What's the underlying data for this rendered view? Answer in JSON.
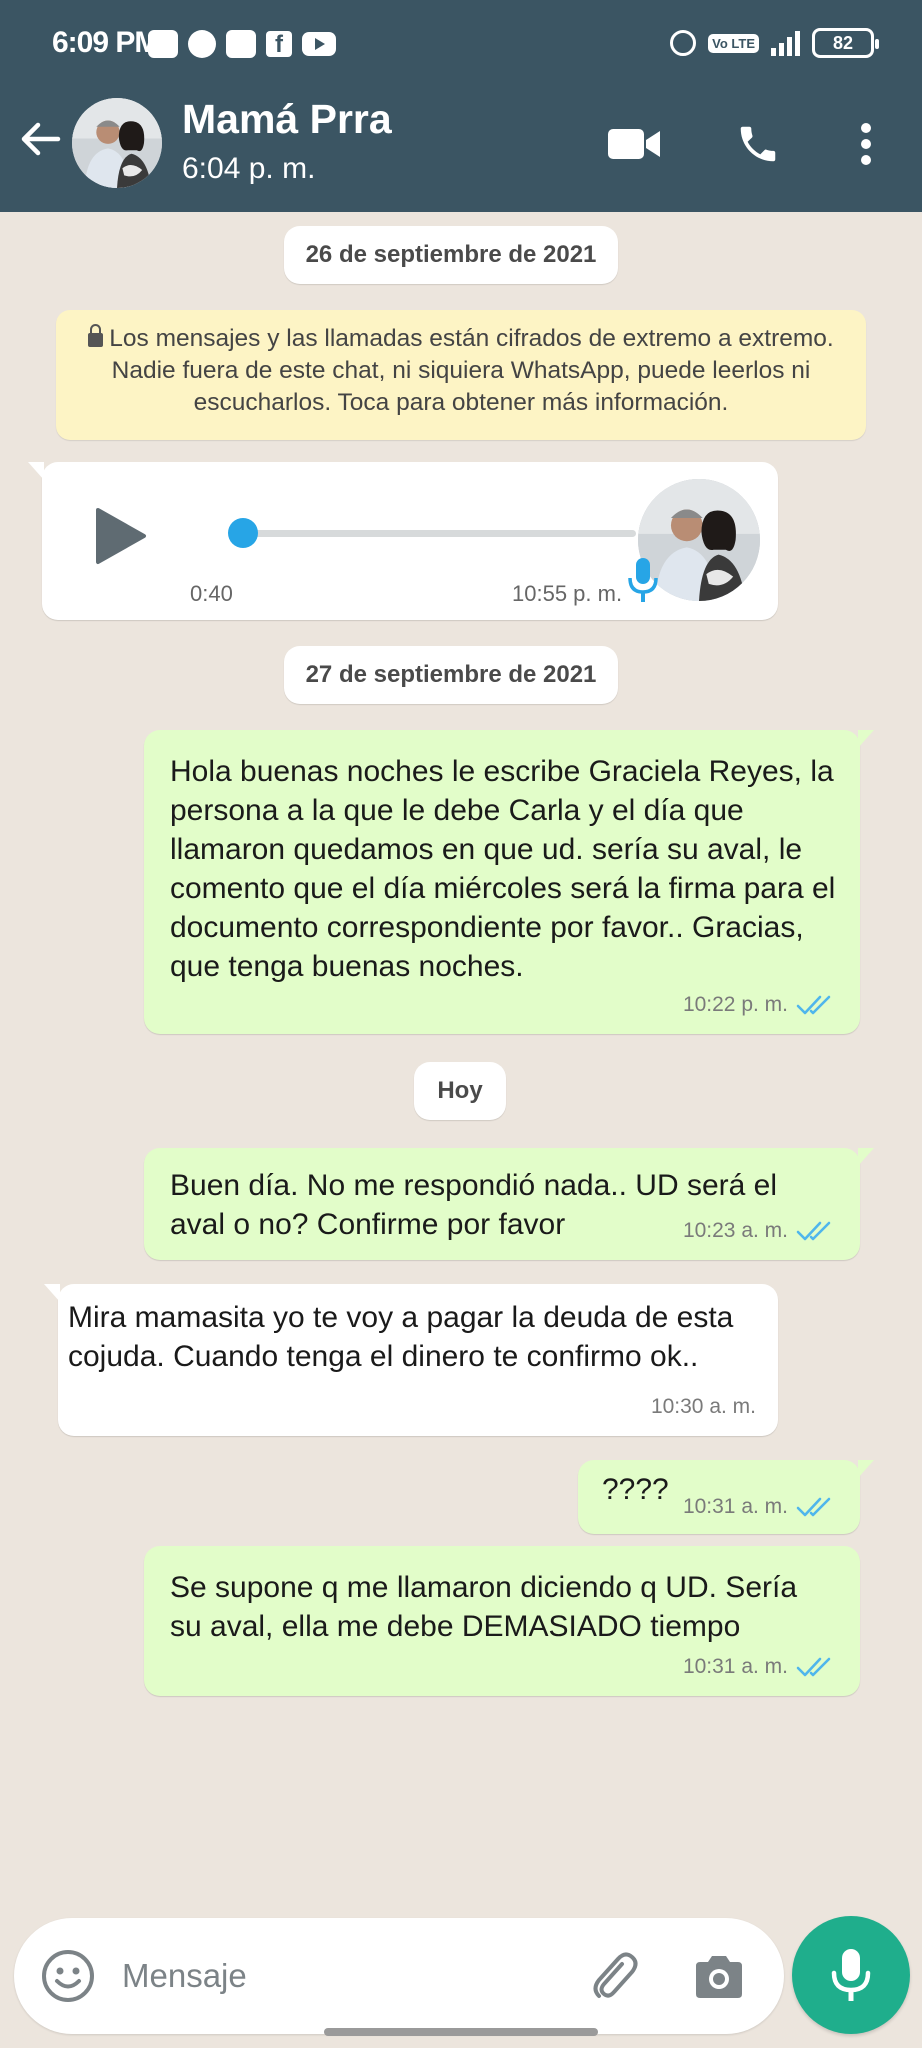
{
  "status_bar": {
    "time": "6:09 PM",
    "battery": "82"
  },
  "header": {
    "contact_name": "Mamá Prra",
    "last_seen": "6:04 p. m."
  },
  "chat": {
    "date_chip_1": "26 de septiembre de 2021",
    "encryption_notice": "Los mensajes y las llamadas están cifrados de extremo a extremo. Nadie fuera de este chat, ni siquiera WhatsApp, puede leerlos ni escucharlos. Toca para obtener más información.",
    "voice_note": {
      "duration": "0:40",
      "time": "10:55 p. m.",
      "progress": 0
    },
    "date_chip_2": "27 de septiembre de 2021",
    "date_chip_3": "Hoy",
    "messages": [
      {
        "direction": "outgoing",
        "text": "Hola buenas noches le escribe Graciela Reyes, la persona a la que le debe Carla y el día que llamaron quedamos en que ud. sería su aval, le comento que el día miércoles será la firma para el documento correspondiente por favor.. Gracias, que tenga buenas noches.",
        "time": "10:22 p. m.",
        "status": "read"
      },
      {
        "direction": "outgoing",
        "text": "Buen día. No me respondió nada.. UD será el aval o no? Confirme por favor",
        "time": "10:23 a. m.",
        "status": "read"
      },
      {
        "direction": "incoming",
        "text": "Mira mamasita yo te voy a pagar la deuda de esta cojuda. Cuando tenga el dinero te confirmo ok..",
        "time": "10:30 a. m."
      },
      {
        "direction": "outgoing",
        "text": "????",
        "time": "10:31 a. m.",
        "status": "read"
      },
      {
        "direction": "outgoing",
        "text": "Se supone q me llamaron diciendo q UD. Sería su aval, ella me debe DEMASIADO tiempo",
        "time": "10:31 a. m.",
        "status": "read"
      }
    ]
  },
  "composer": {
    "placeholder": "Mensaje"
  },
  "colors": {
    "header_bg": "#3b5563",
    "chat_bg": "#ece5dd",
    "outgoing_bubble": "#e2fdc9",
    "incoming_bubble": "#ffffff",
    "read_ticks": "#4fb6ec",
    "mic_button": "#1fae8c",
    "encryption_notice_bg": "#fdf4c5"
  },
  "icons": [
    "back-arrow-icon",
    "video-call-icon",
    "phone-icon",
    "more-vert-icon",
    "lock-icon",
    "play-icon",
    "mic-icon",
    "double-check-icon",
    "emoji-icon",
    "paperclip-icon",
    "camera-icon"
  ]
}
